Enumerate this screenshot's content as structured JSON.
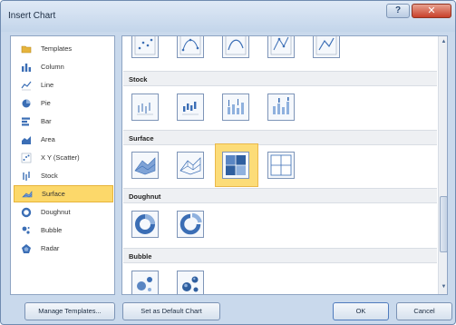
{
  "window": {
    "title": "Insert Chart",
    "help_glyph": "?",
    "close_glyph": "✕"
  },
  "sidebar": {
    "items": [
      {
        "label": "Templates",
        "icon": "folder-icon",
        "color": "#e6b43c"
      },
      {
        "label": "Column",
        "icon": "column-chart-icon",
        "color": "#3b6eb5"
      },
      {
        "label": "Line",
        "icon": "line-chart-icon",
        "color": "#3b6eb5"
      },
      {
        "label": "Pie",
        "icon": "pie-chart-icon",
        "color": "#3b6eb5"
      },
      {
        "label": "Bar",
        "icon": "bar-chart-icon",
        "color": "#3b6eb5"
      },
      {
        "label": "Area",
        "icon": "area-chart-icon",
        "color": "#3b6eb5"
      },
      {
        "label": "X Y (Scatter)",
        "icon": "scatter-chart-icon",
        "color": "#3b6eb5"
      },
      {
        "label": "Stock",
        "icon": "stock-chart-icon",
        "color": "#3b6eb5"
      },
      {
        "label": "Surface",
        "icon": "surface-chart-icon",
        "color": "#3b6eb5"
      },
      {
        "label": "Doughnut",
        "icon": "doughnut-chart-icon",
        "color": "#3b6eb5"
      },
      {
        "label": "Bubble",
        "icon": "bubble-chart-icon",
        "color": "#3b6eb5"
      },
      {
        "label": "Radar",
        "icon": "radar-chart-icon",
        "color": "#3b6eb5"
      }
    ],
    "selected_index": 8
  },
  "gallery": {
    "sections": [
      {
        "label": "Stock",
        "thumb_icons": [
          "stock-hlc-icon",
          "stock-ohlc-icon",
          "stock-vhlc-icon",
          "stock-vohlc-icon"
        ]
      },
      {
        "label": "Surface",
        "thumb_icons": [
          "surface-3d-icon",
          "wireframe-3d-surface-icon",
          "contour-icon",
          "wireframe-contour-icon"
        ],
        "selected_index": 2
      },
      {
        "label": "Doughnut",
        "thumb_icons": [
          "doughnut-icon",
          "exploded-doughnut-icon"
        ]
      },
      {
        "label": "Bubble",
        "thumb_icons": [
          "bubble-icon",
          "bubble-3d-icon"
        ]
      }
    ],
    "top_row_icons": [
      "scatter-markers-icon",
      "scatter-smooth-markers-icon",
      "scatter-smooth-icon",
      "scatter-straight-markers-icon",
      "scatter-straight-icon"
    ]
  },
  "buttons": {
    "manage_templates": "Manage Templates...",
    "set_default": "Set as Default Chart",
    "ok": "OK",
    "cancel": "Cancel"
  },
  "colors": {
    "accent_blue": "#3b6eb5",
    "selection_fill": "#fcd86a",
    "close_red": "#c8402a"
  }
}
